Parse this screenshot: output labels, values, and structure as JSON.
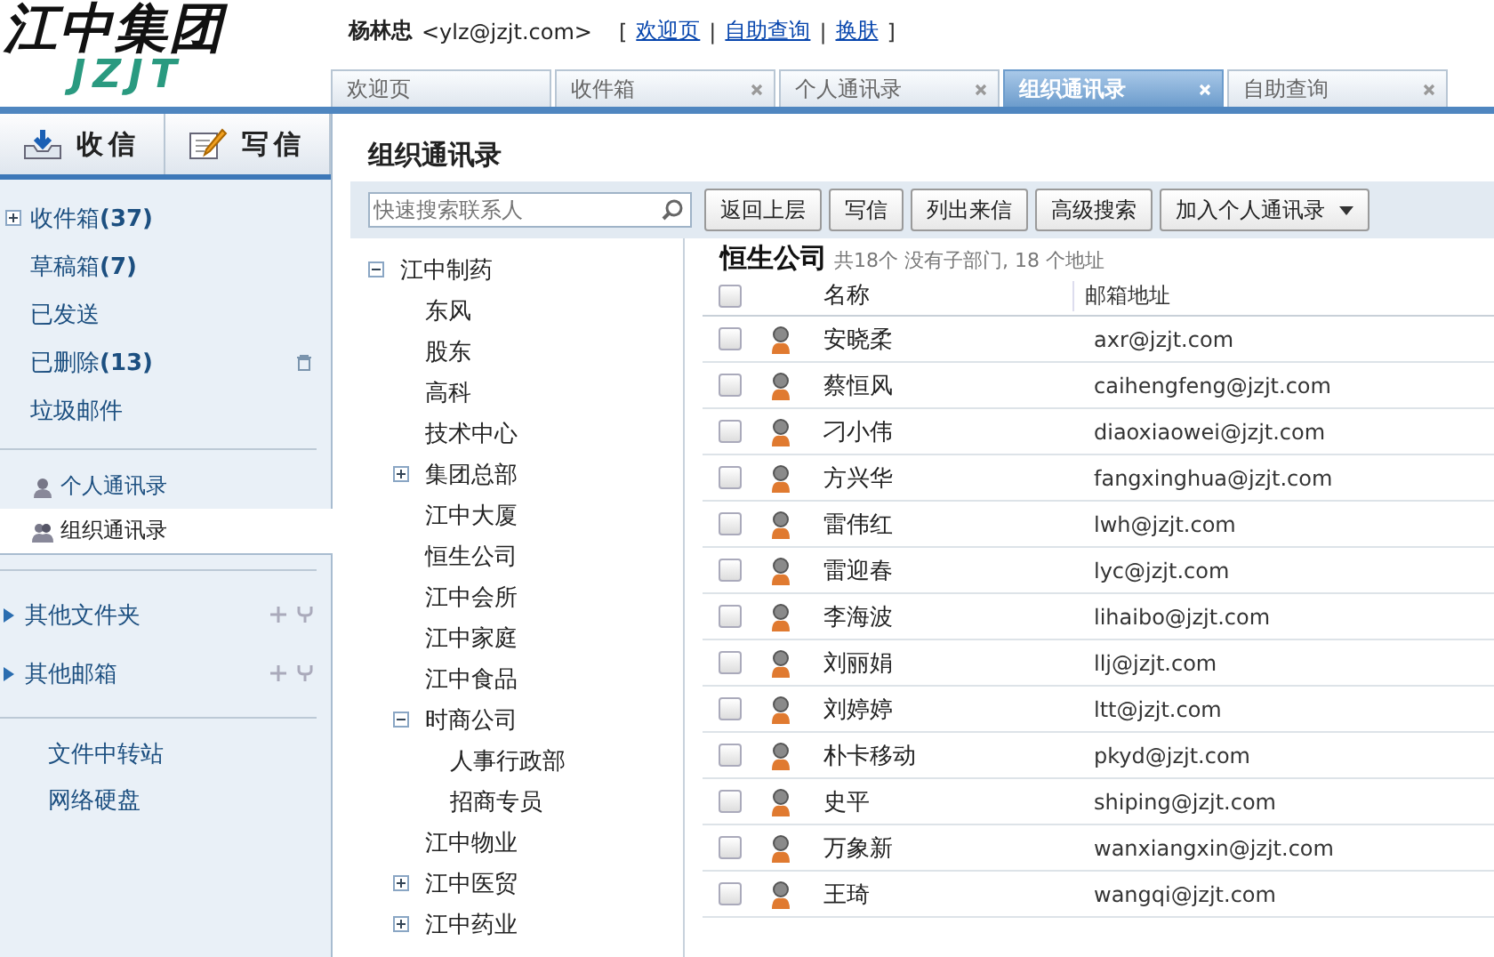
{
  "logo": {
    "text": "江中集团",
    "subtext": "JZJT"
  },
  "user": {
    "name": "杨林忠",
    "email": "<ylz@jzjt.com>",
    "open_bracket": "[",
    "separator": "|",
    "close_bracket": "]",
    "links": [
      "欢迎页",
      "自助查询",
      "换肤"
    ]
  },
  "tabs": [
    {
      "label": "欢迎页",
      "selected": false,
      "closable": false
    },
    {
      "label": "收件箱",
      "selected": false,
      "closable": true
    },
    {
      "label": "个人通讯录",
      "selected": false,
      "closable": true
    },
    {
      "label": "组织通讯录",
      "selected": true,
      "closable": true
    },
    {
      "label": "自助查询",
      "selected": false,
      "closable": true
    }
  ],
  "sidebar": {
    "receive_button": "收信",
    "compose_button": "写信",
    "folders": [
      {
        "label": "收件箱",
        "count": "(37)",
        "expandable": true,
        "trash": false
      },
      {
        "label": "草稿箱",
        "count": "(7)",
        "expandable": false,
        "trash": false
      },
      {
        "label": "已发送",
        "expandable": false,
        "trash": false
      },
      {
        "label": "已删除",
        "count": "(13)",
        "expandable": false,
        "trash": true
      },
      {
        "label": "垃圾邮件",
        "expandable": false,
        "trash": false
      }
    ],
    "contacts": [
      {
        "label": "个人通讯录",
        "selected": false
      },
      {
        "label": "组织通讯录",
        "selected": true
      }
    ],
    "groups": [
      "其他文件夹",
      "其他邮箱"
    ],
    "tools": [
      "文件中转站",
      "网络硬盘"
    ]
  },
  "page_title": "组织通讯录",
  "search": {
    "placeholder": "快速搜索联系人"
  },
  "tree": [
    {
      "label": "江中制药",
      "expanded": true,
      "children": [
        {
          "label": "东风"
        },
        {
          "label": "股东"
        },
        {
          "label": "高科"
        },
        {
          "label": "技术中心"
        },
        {
          "label": "集团总部",
          "expanded": false
        },
        {
          "label": "江中大厦"
        },
        {
          "label": "恒生公司"
        },
        {
          "label": "江中会所"
        },
        {
          "label": "江中家庭"
        },
        {
          "label": "江中食品"
        },
        {
          "label": "时商公司",
          "expanded": true,
          "children": [
            {
              "label": "人事行政部"
            },
            {
              "label": "招商专员"
            }
          ]
        },
        {
          "label": "江中物业"
        },
        {
          "label": "江中医贸",
          "expanded": false
        },
        {
          "label": "江中药业",
          "expanded": false
        }
      ]
    }
  ],
  "toolbar": [
    "返回上层",
    "写信",
    "列出来信",
    "高级搜索",
    "加入个人通讯录"
  ],
  "department": {
    "name": "恒生公司",
    "summary": "共18个 没有子部门, 18 个地址"
  },
  "table": {
    "all_checked": false,
    "columns": [
      "名称",
      "邮箱地址"
    ],
    "rows": [
      {
        "name": "安晓柔",
        "email": "axr@jzjt.com",
        "checked": false
      },
      {
        "name": "蔡恒风",
        "email": "caihengfeng@jzjt.com",
        "checked": false
      },
      {
        "name": "刁小伟",
        "email": "diaoxiaowei@jzjt.com",
        "checked": false
      },
      {
        "name": "方兴华",
        "email": "fangxinghua@jzjt.com",
        "checked": false
      },
      {
        "name": "雷伟红",
        "email": "lwh@jzjt.com",
        "checked": false
      },
      {
        "name": "雷迎春",
        "email": "lyc@jzjt.com",
        "checked": false
      },
      {
        "name": "李海波",
        "email": "lihaibo@jzjt.com",
        "checked": false
      },
      {
        "name": "刘丽娟",
        "email": "llj@jzjt.com",
        "checked": false
      },
      {
        "name": "刘婷婷",
        "email": "ltt@jzjt.com",
        "checked": false
      },
      {
        "name": "朴卡移动",
        "email": "pkyd@jzjt.com",
        "checked": false
      },
      {
        "name": "史平",
        "email": "shiping@jzjt.com",
        "checked": false
      },
      {
        "name": "万象新",
        "email": "wanxiangxin@jzjt.com",
        "checked": false
      },
      {
        "name": "王琦",
        "email": "wangqi@jzjt.com",
        "checked": false
      }
    ]
  }
}
